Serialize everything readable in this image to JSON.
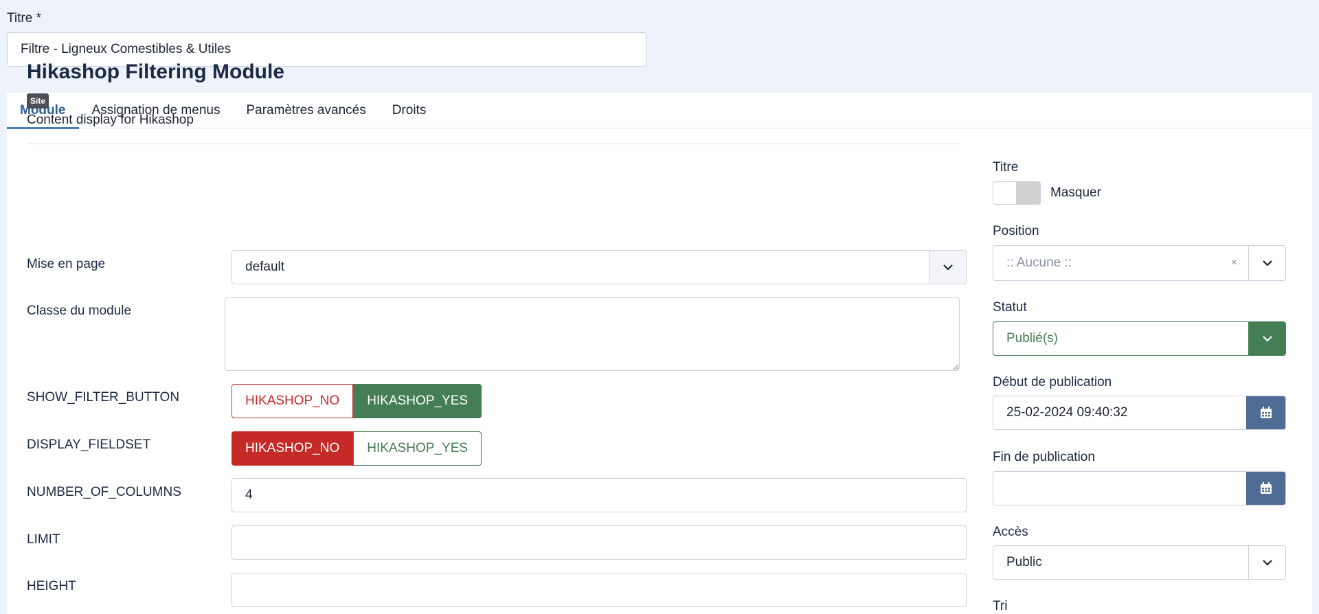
{
  "title_field": {
    "label": "Titre *",
    "value": "Filtre - Ligneux Comestibles & Utiles"
  },
  "tabs": [
    {
      "label": "Module",
      "active": true
    },
    {
      "label": "Assignation de menus",
      "active": false
    },
    {
      "label": "Paramètres avancés",
      "active": false
    },
    {
      "label": "Droits",
      "active": false
    }
  ],
  "module": {
    "title": "Hikashop Filtering Module",
    "badge": "Site",
    "description": "Content display for Hikashop"
  },
  "fields": {
    "layout": {
      "label": "Mise en page",
      "value": "default"
    },
    "module_class": {
      "label": "Classe du module",
      "value": ""
    },
    "show_filter_button": {
      "label": "SHOW_FILTER_BUTTON",
      "no_label": "HIKASHOP_NO",
      "yes_label": "HIKASHOP_YES",
      "selected": "yes"
    },
    "display_fieldset": {
      "label": "DISPLAY_FIELDSET",
      "no_label": "HIKASHOP_NO",
      "yes_label": "HIKASHOP_YES",
      "selected": "no"
    },
    "number_of_columns": {
      "label": "NUMBER_OF_COLUMNS",
      "value": "4"
    },
    "limit": {
      "label": "LIMIT",
      "value": ""
    },
    "height": {
      "label": "HEIGHT",
      "value": ""
    }
  },
  "sidebar": {
    "titre": {
      "label": "Titre",
      "toggle_label": "Masquer"
    },
    "position": {
      "label": "Position",
      "placeholder": ":: Aucune ::",
      "clear": "×"
    },
    "statut": {
      "label": "Statut",
      "value": "Publié(s)"
    },
    "publish_up": {
      "label": "Début de publication",
      "value": "25-02-2024 09:40:32"
    },
    "publish_down": {
      "label": "Fin de publication",
      "value": ""
    },
    "acces": {
      "label": "Accès",
      "value": "Public"
    },
    "tri": {
      "label": "Tri"
    }
  },
  "colors": {
    "accent": "#2f5f97",
    "danger": "#c52a26",
    "success": "#457d54",
    "calendar": "#4e6c94"
  }
}
